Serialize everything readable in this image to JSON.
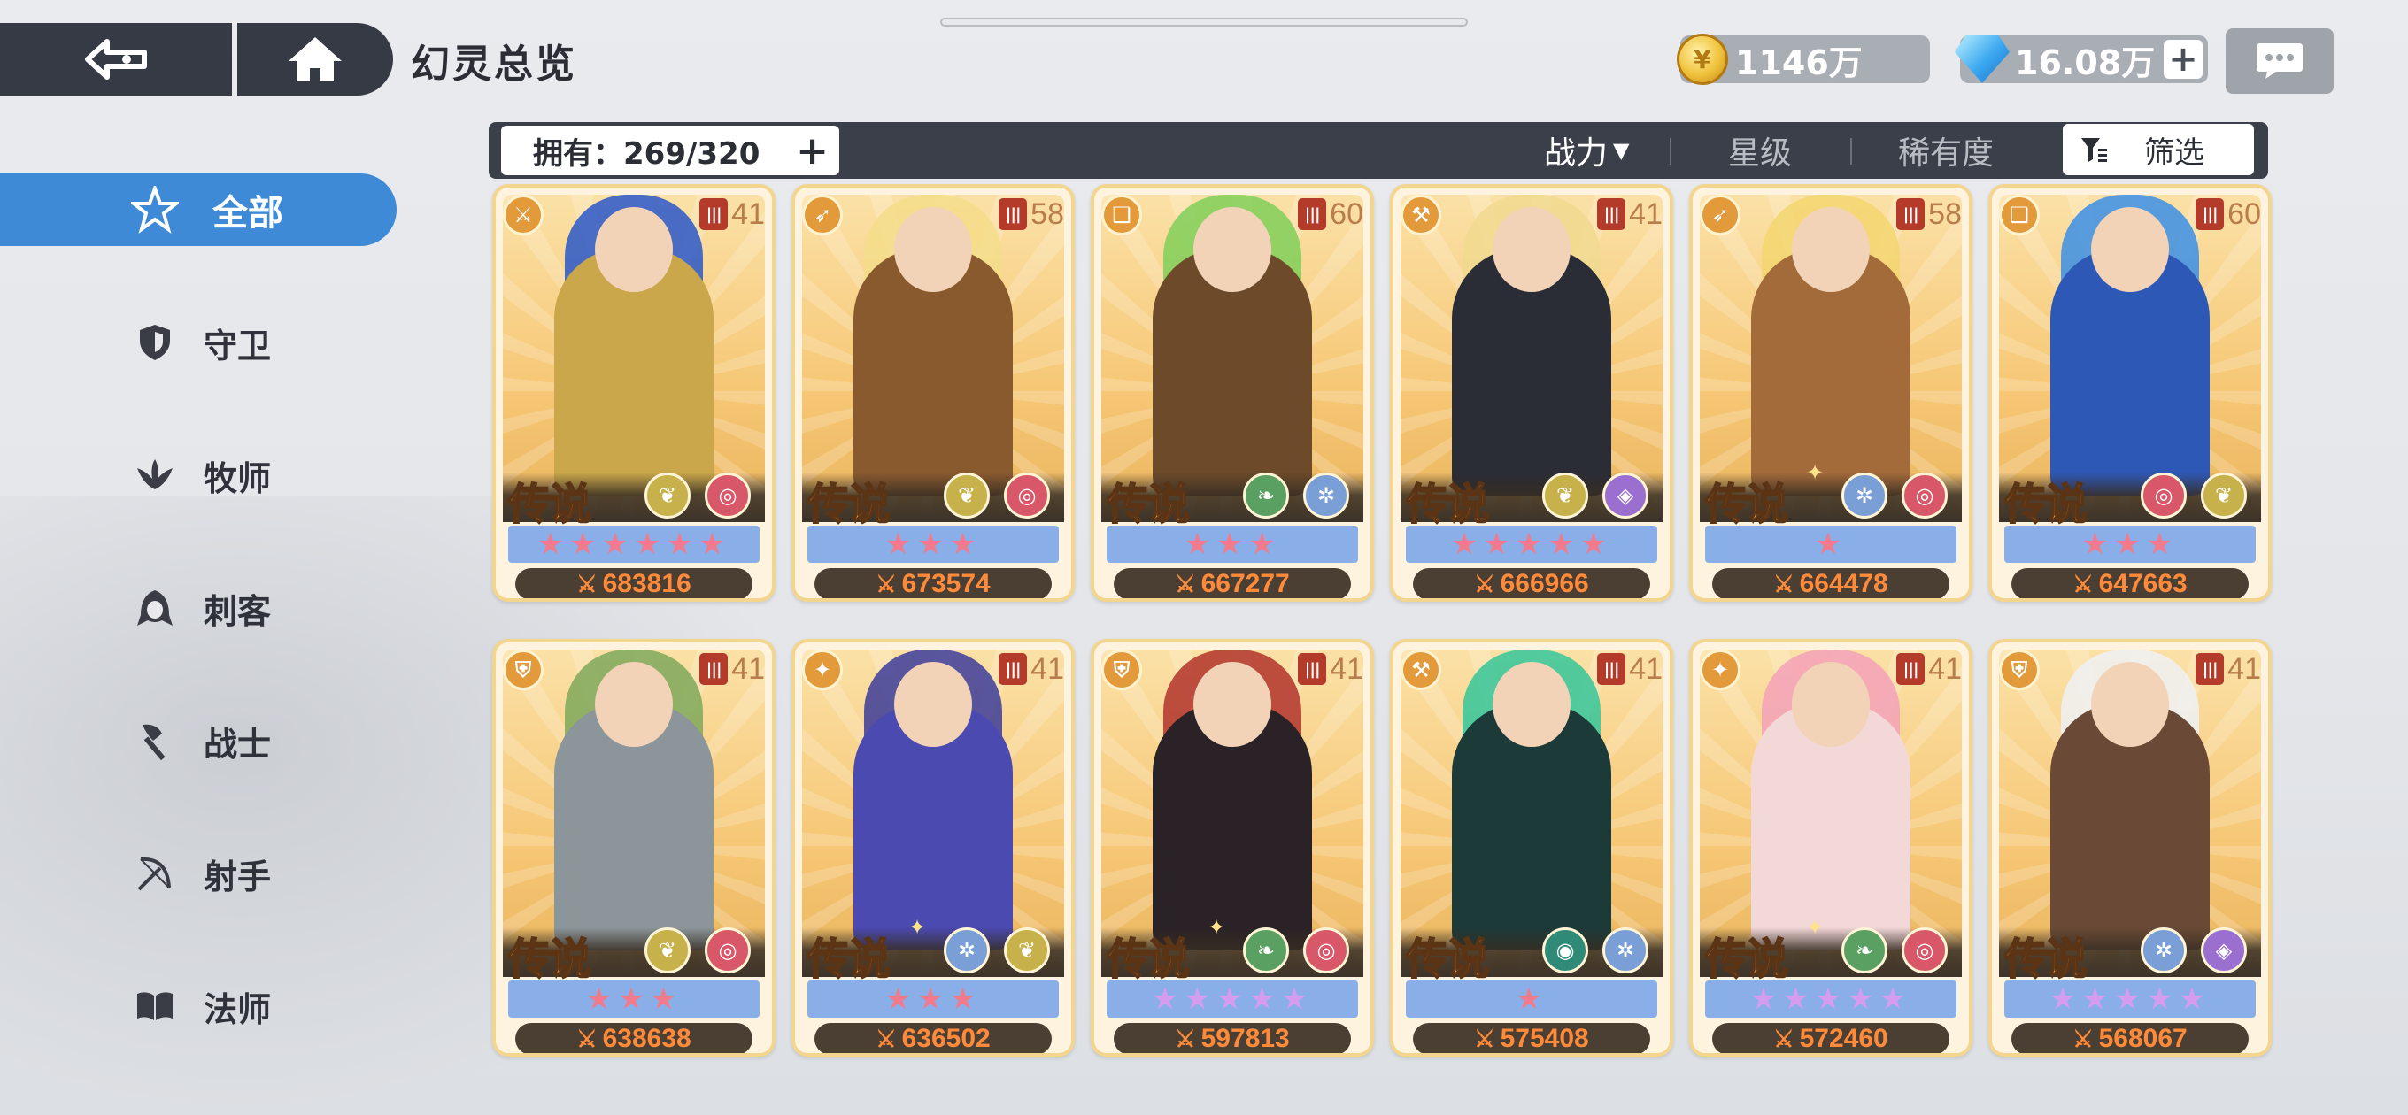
{
  "header": {
    "title": "幻灵总览",
    "gold": "1146万",
    "gems": "16.08万"
  },
  "filter_bar": {
    "owned": "拥有：269/320",
    "sort_power": "战力",
    "sort_star": "星级",
    "sort_rarity": "稀有度",
    "filter": "筛选"
  },
  "sidebar": {
    "items": [
      {
        "label": "全部",
        "icon": "all-star-icon",
        "active": true
      },
      {
        "label": "守卫",
        "icon": "shield-icon"
      },
      {
        "label": "牧师",
        "icon": "priest-wings-icon"
      },
      {
        "label": "刺客",
        "icon": "assassin-hood-icon"
      },
      {
        "label": "战士",
        "icon": "warrior-axe-icon"
      },
      {
        "label": "射手",
        "icon": "archer-bow-icon"
      },
      {
        "label": "法师",
        "icon": "mage-book-icon"
      }
    ]
  },
  "cards": [
    {
      "level": "41",
      "rarity": "传说",
      "plus": false,
      "stars": "★★★★★★",
      "star_color": "red",
      "power": "683816",
      "class_icon": "warrior-spear-icon",
      "badges": [
        "wings-badge",
        "spiral-badge"
      ],
      "colors": {
        "body": "#c9a74a",
        "hair": "#2a57c9"
      }
    },
    {
      "level": "58",
      "rarity": "传说",
      "plus": false,
      "stars": "★★★",
      "star_color": "red",
      "power": "673574",
      "class_icon": "archer-bow-icon",
      "badges": [
        "wings-badge",
        "spiral-badge"
      ],
      "colors": {
        "body": "#8a5a2f",
        "hair": "#f3dd8a"
      }
    },
    {
      "level": "60",
      "rarity": "传说",
      "plus": false,
      "stars": "★★★",
      "star_color": "red",
      "power": "667277",
      "class_icon": "mage-book-icon",
      "badges": [
        "leaf-badge",
        "snowflake-badge"
      ],
      "colors": {
        "body": "#6c4a2a",
        "hair": "#7fcf58"
      }
    },
    {
      "level": "41",
      "rarity": "传说",
      "plus": false,
      "stars": "★★★★★",
      "star_color": "red",
      "power": "666966",
      "class_icon": "warrior-axe-icon",
      "badges": [
        "wings-badge",
        "diamond-eye-badge"
      ],
      "colors": {
        "body": "#2a2c36",
        "hair": "#f1d98f"
      }
    },
    {
      "level": "58",
      "rarity": "传说",
      "plus": true,
      "stars": "★",
      "star_color": "red",
      "power": "664478",
      "class_icon": "archer-bow-icon",
      "badges": [
        "snowflake-badge",
        "spiral-badge"
      ],
      "colors": {
        "body": "#a36a3a",
        "hair": "#f3d670"
      }
    },
    {
      "level": "60",
      "rarity": "传说",
      "plus": false,
      "stars": "★★★",
      "star_color": "red",
      "power": "647663",
      "class_icon": "mage-book-icon",
      "badges": [
        "spiral-badge",
        "wings-badge"
      ],
      "colors": {
        "body": "#2e58b6",
        "hair": "#3b8fe6"
      }
    },
    {
      "level": "41",
      "rarity": "传说",
      "plus": false,
      "stars": "★★★",
      "star_color": "red",
      "power": "638638",
      "class_icon": "shield-icon",
      "badges": [
        "wings-badge",
        "spiral-badge"
      ],
      "colors": {
        "body": "#8c969a",
        "hair": "#7ea85a"
      }
    },
    {
      "level": "41",
      "rarity": "传说",
      "plus": true,
      "stars": "★★★",
      "star_color": "red",
      "power": "636502",
      "class_icon": "priest-wings-icon",
      "badges": [
        "snowflake-badge",
        "wings-badge"
      ],
      "colors": {
        "body": "#4a4ab0",
        "hair": "#3c3c9a"
      }
    },
    {
      "level": "41",
      "rarity": "传说",
      "plus": true,
      "stars": "★★★★★",
      "star_color": "purple",
      "power": "597813",
      "class_icon": "shield-icon",
      "badges": [
        "leaf-badge",
        "spiral-badge"
      ],
      "colors": {
        "body": "#2a2226",
        "hair": "#b0322a"
      }
    },
    {
      "level": "41",
      "rarity": "传说",
      "plus": false,
      "stars": "★",
      "star_color": "red",
      "power": "575408",
      "class_icon": "warrior-axe-icon",
      "badges": [
        "mask-badge",
        "snowflake-badge"
      ],
      "colors": {
        "body": "#1c3a38",
        "hair": "#34c69a"
      }
    },
    {
      "level": "41",
      "rarity": "传说",
      "plus": true,
      "stars": "★★★★★",
      "star_color": "purple",
      "power": "572460",
      "class_icon": "priest-wings-icon",
      "badges": [
        "leaf-badge",
        "spiral-badge"
      ],
      "colors": {
        "body": "#f3d8d8",
        "hair": "#f3a1b8"
      }
    },
    {
      "level": "41",
      "rarity": "传说",
      "plus": false,
      "stars": "★★★★★",
      "star_color": "purple",
      "power": "568067",
      "class_icon": "shield-icon",
      "badges": [
        "snowflake-badge",
        "diamond-eye-badge"
      ],
      "colors": {
        "body": "#6a4a36",
        "hair": "#eef1f4"
      }
    }
  ],
  "badge_colors": {
    "wings-badge": "#c6b14a",
    "spiral-badge": "#d8586a",
    "leaf-badge": "#5aa063",
    "snowflake-badge": "#7a9fd6",
    "diamond-eye-badge": "#9a6fd0",
    "mask-badge": "#2f8a78"
  }
}
